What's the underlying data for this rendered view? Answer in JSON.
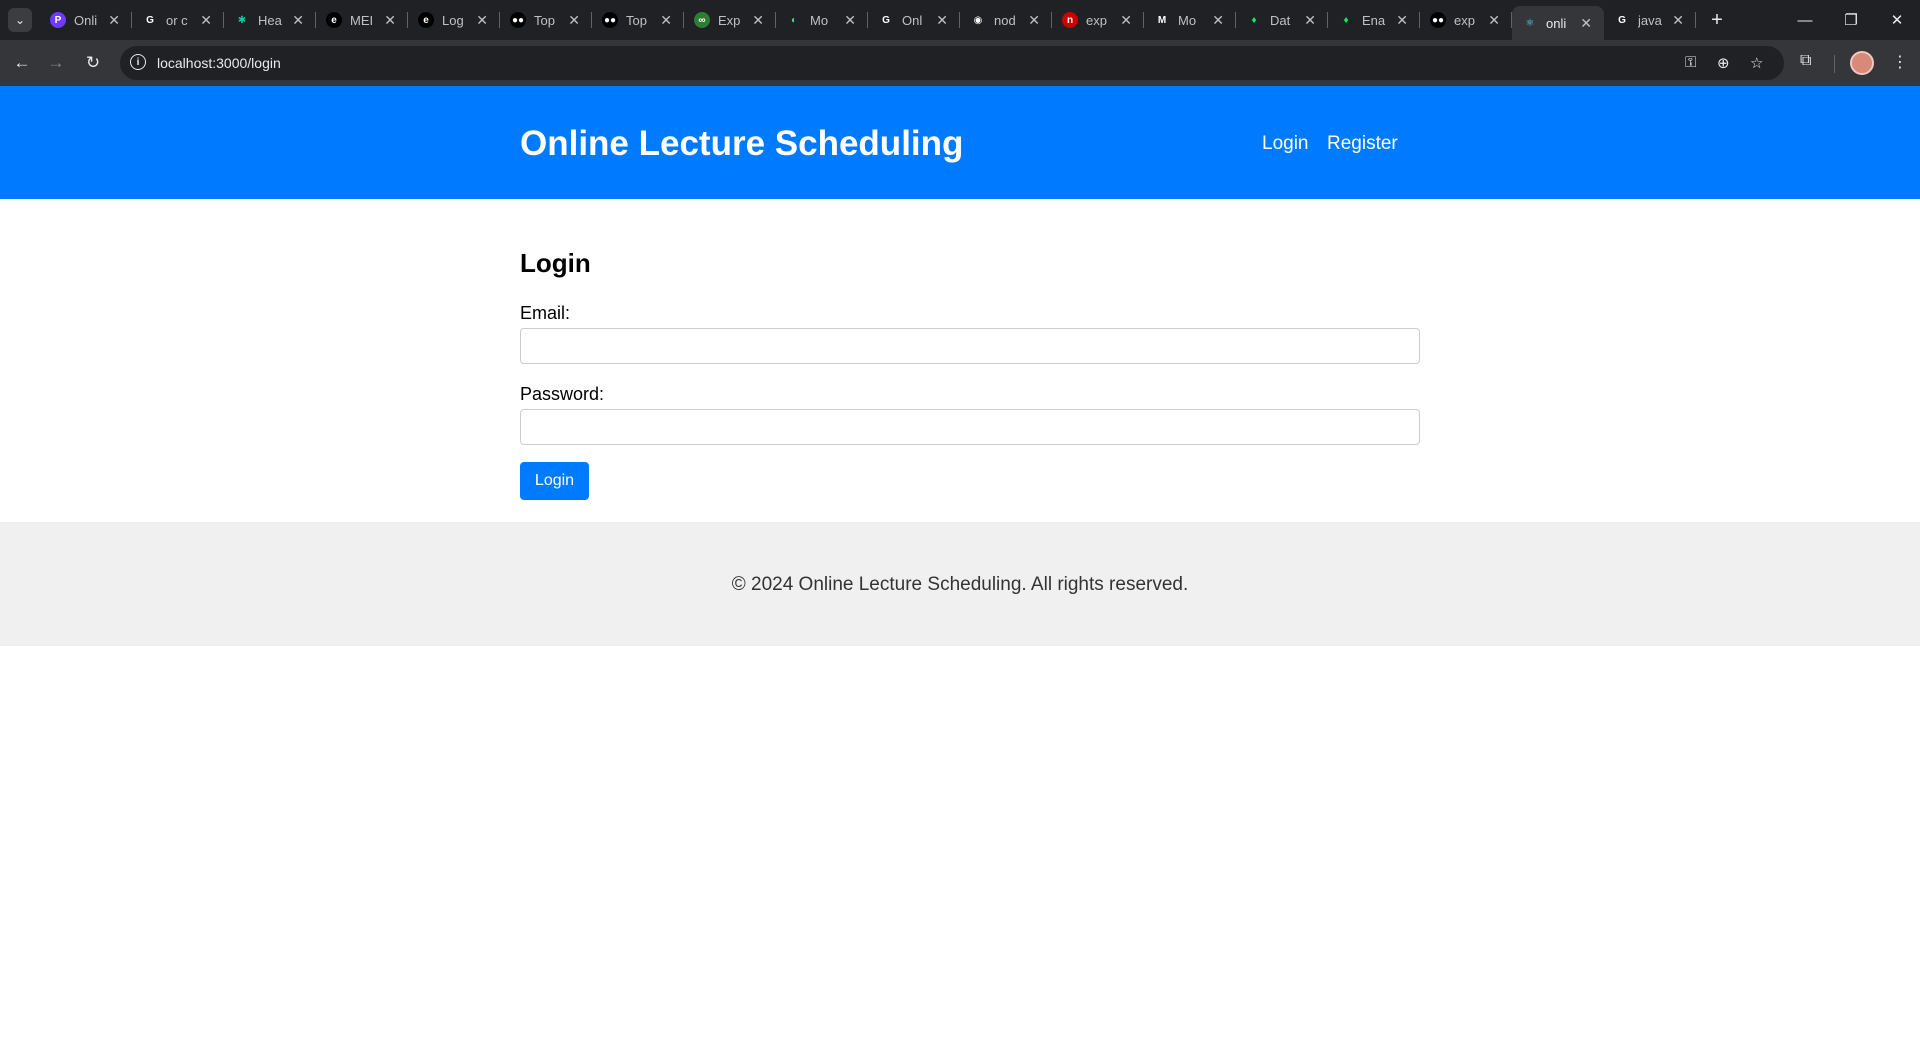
{
  "browser": {
    "tabs": [
      {
        "title": "Onli",
        "icon": "site-icon",
        "color": "#6c3bff",
        "glyph": "P"
      },
      {
        "title": "or c",
        "icon": "google-icon",
        "color": "#ffffff",
        "glyph": "G"
      },
      {
        "title": "Hea",
        "icon": "star-icon",
        "color": "#19c6a6",
        "glyph": "✱"
      },
      {
        "title": "MEI",
        "icon": "site-icon",
        "color": "#000000",
        "glyph": "e"
      },
      {
        "title": "Log",
        "icon": "site-icon",
        "color": "#000000",
        "glyph": "e"
      },
      {
        "title": "Top",
        "icon": "medium-icon",
        "color": "#000000",
        "glyph": "●●"
      },
      {
        "title": "Top",
        "icon": "medium-icon",
        "color": "#000000",
        "glyph": "●●"
      },
      {
        "title": "Exp",
        "icon": "site-icon",
        "color": "#2e7d32",
        "glyph": "∞"
      },
      {
        "title": "Mo",
        "icon": "site-icon",
        "color": "#3ddc84",
        "glyph": "◐"
      },
      {
        "title": "Onl",
        "icon": "google-icon",
        "color": "#ffffff",
        "glyph": "G"
      },
      {
        "title": "nod",
        "icon": "github-icon",
        "color": "#ffffff",
        "glyph": "◉"
      },
      {
        "title": "exp",
        "icon": "npm-icon",
        "color": "#cb0000",
        "glyph": "n"
      },
      {
        "title": "Mo",
        "icon": "site-icon",
        "color": "#ffffff",
        "glyph": "M"
      },
      {
        "title": "Dat",
        "icon": "mongodb-icon",
        "color": "#00ed64",
        "glyph": "♦"
      },
      {
        "title": "Ena",
        "icon": "mongodb-icon",
        "color": "#00ed64",
        "glyph": "♦"
      },
      {
        "title": "exp",
        "icon": "medium-icon",
        "color": "#000000",
        "glyph": "●●"
      },
      {
        "title": "onli",
        "icon": "react-icon",
        "color": "#61dafb",
        "glyph": "⚛",
        "active": true
      },
      {
        "title": "java",
        "icon": "google-icon",
        "color": "#ffffff",
        "glyph": "G"
      }
    ],
    "url": "localhost:3000/login"
  },
  "header": {
    "title": "Online Lecture Scheduling",
    "nav": {
      "login": "Login",
      "register": "Register"
    }
  },
  "login_form": {
    "heading": "Login",
    "email_label": "Email:",
    "email_value": "",
    "password_label": "Password:",
    "password_value": "",
    "submit_label": "Login"
  },
  "footer": {
    "text": "© 2024 Online Lecture Scheduling. All rights reserved."
  },
  "colors": {
    "brand": "#007bff",
    "footer_bg": "#f0f0f0"
  }
}
